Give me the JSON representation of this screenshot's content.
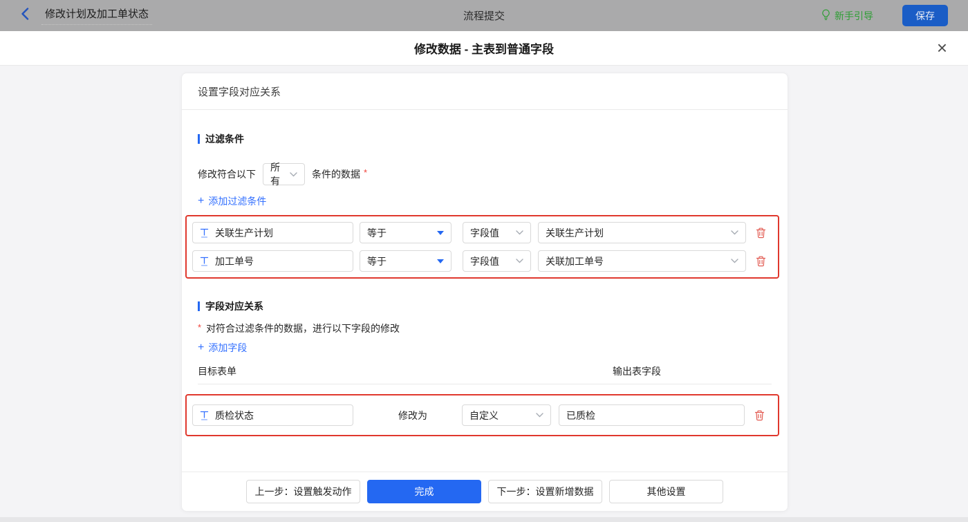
{
  "colors": {
    "accent_blue": "#2468f2",
    "link_blue": "#3370ff",
    "highlight_red": "#e0382d",
    "trash_red": "#e25b52",
    "guide_green": "#2f9e35",
    "save_blue_dimmed": "#1a5dc6"
  },
  "icons": {
    "close": "×",
    "plus": "+"
  },
  "topbar": {
    "back_title": "修改计划及加工单状态",
    "center_title": "流程提交",
    "guide_label": "新手引导",
    "save_label": "保存"
  },
  "dialog": {
    "title": "修改数据 - 主表到普通字段"
  },
  "panel": {
    "header": "设置字段对应关系",
    "filter": {
      "title": "过滤条件",
      "prefix": "修改符合以下",
      "match_value": "所有",
      "suffix": "条件的数据",
      "required_mark": "*",
      "add_link": "添加过滤条件",
      "conditions": [
        {
          "field": "关联生产计划",
          "operator": "等于",
          "value_type": "字段值",
          "value": "关联生产计划"
        },
        {
          "field": "加工单号",
          "operator": "等于",
          "value_type": "字段值",
          "value": "关联加工单号"
        }
      ]
    },
    "mapping": {
      "title": "字段对应关系",
      "required_mark": "*",
      "description": "对符合过滤条件的数据，进行以下字段的修改",
      "add_link": "添加字段",
      "col_left": "目标表单",
      "col_right": "输出表字段",
      "rows": [
        {
          "field": "质检状态",
          "action_label": "修改为",
          "mode": "自定义",
          "value": "已质检"
        }
      ]
    },
    "footer": {
      "prev": "上一步：设置触发动作",
      "done": "完成",
      "next": "下一步：设置新增数据",
      "other": "其他设置"
    }
  }
}
